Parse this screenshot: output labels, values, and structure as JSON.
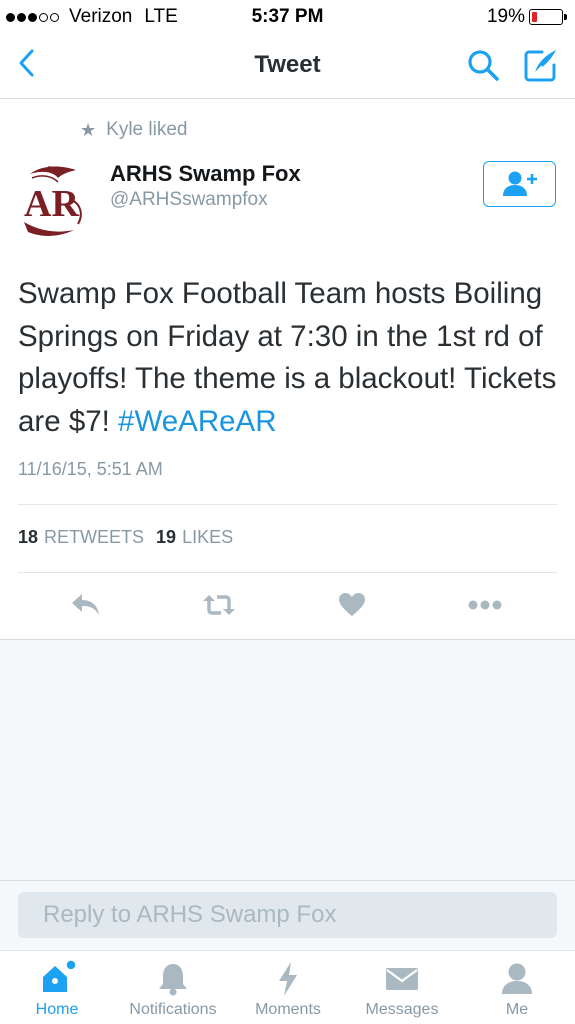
{
  "status_bar": {
    "carrier": "Verizon",
    "network": "LTE",
    "time": "5:37 PM",
    "battery_percent_text": "19%",
    "battery_level": 0.19,
    "battery_color": "#e0262a"
  },
  "nav": {
    "title": "Tweet",
    "back_icon": "chevron-left-icon",
    "search_icon": "search-icon",
    "compose_icon": "compose-icon",
    "accent_color": "#1da1f2"
  },
  "tweet": {
    "social_context": "Kyle liked",
    "author_name": "ARHS Swamp Fox",
    "author_handle": "@ARHSswampfox",
    "avatar_text": "AR",
    "text": "Swamp Fox Football Team hosts Boiling Springs on Friday at 7:30 in the 1st rd of playoffs! The theme is a blackout! Tickets are $7! ",
    "hashtag": "#WeAReAR",
    "timestamp": "11/16/15, 5:51 AM",
    "retweets_count": "18",
    "retweets_label": "RETWEETS",
    "likes_count": "19",
    "likes_label": "LIKES"
  },
  "reply": {
    "placeholder": "Reply to ARHS Swamp Fox"
  },
  "tab_bar": {
    "tabs": [
      {
        "label": "Home",
        "icon": "home-icon",
        "active": true
      },
      {
        "label": "Notifications",
        "icon": "bell-icon",
        "active": false
      },
      {
        "label": "Moments",
        "icon": "lightning-icon",
        "active": false
      },
      {
        "label": "Messages",
        "icon": "envelope-icon",
        "active": false
      },
      {
        "label": "Me",
        "icon": "person-icon",
        "active": false
      }
    ]
  }
}
